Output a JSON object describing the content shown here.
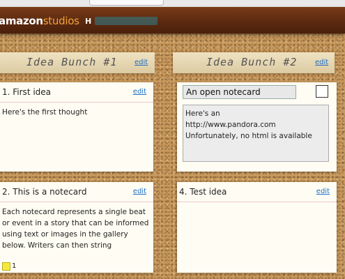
{
  "header": {
    "logo_amazon": "amazon",
    "logo_studios": "studios",
    "user_initial": "H"
  },
  "bunches": [
    {
      "title": "Idea Bunch #1",
      "edit_label": "edit"
    },
    {
      "title": "Idea Bunch #2",
      "edit_label": "edit"
    }
  ],
  "cards": {
    "card1": {
      "title": "1.  First idea",
      "edit_label": "edit",
      "body": "Here's the first thought"
    },
    "card2": {
      "title": "2.  This is a notecard",
      "edit_label": "edit",
      "body": "Each notecard represents a single beat or event in a story that can be informed using text or images in the gallery below. Writers can then string",
      "count": "1"
    },
    "open": {
      "title_value": "An open notecard",
      "body_value": "Here's an\nhttp://www.pandora.com\nUnfortunately, no html is available"
    },
    "card4": {
      "title": "4.  Test idea",
      "edit_label": "edit"
    }
  },
  "colors": {
    "accent_orange": "#f3a33a",
    "link_blue": "#1a6fc9",
    "header_brown": "#5c2a10",
    "count_yellow": "#f5ea3c"
  }
}
